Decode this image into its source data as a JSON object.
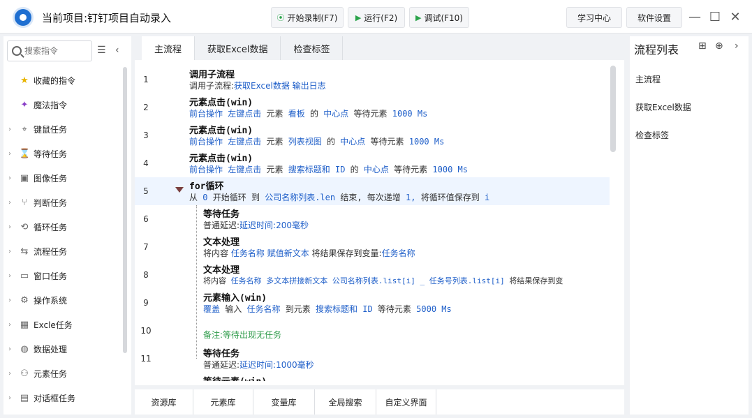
{
  "titlebar": {
    "project_title": "当前项目:钉钉项目自动录入",
    "record_label": "开始录制(F7)",
    "run_label": "运行(F2)",
    "debug_label": "调试(F10)",
    "learn_label": "学习中心",
    "settings_label": "软件设置"
  },
  "sidebar": {
    "search_placeholder": "搜索指令",
    "items": [
      {
        "label": "收藏的指令",
        "icon": "star-icon"
      },
      {
        "label": "魔法指令",
        "icon": "magic-wand-icon"
      },
      {
        "label": "键鼠任务",
        "icon": "mouse-icon"
      },
      {
        "label": "等待任务",
        "icon": "hourglass-icon"
      },
      {
        "label": "图像任务",
        "icon": "image-icon"
      },
      {
        "label": "判断任务",
        "icon": "branch-icon"
      },
      {
        "label": "循环任务",
        "icon": "loop-icon"
      },
      {
        "label": "流程任务",
        "icon": "flow-icon"
      },
      {
        "label": "窗口任务",
        "icon": "window-icon"
      },
      {
        "label": "操作系统",
        "icon": "gear-icon"
      },
      {
        "label": "Excle任务",
        "icon": "excel-icon"
      },
      {
        "label": "数据处理",
        "icon": "database-icon"
      },
      {
        "label": "元素任务",
        "icon": "element-icon"
      },
      {
        "label": "对话框任务",
        "icon": "dialog-icon"
      }
    ]
  },
  "tabs": [
    "主流程",
    "获取Excel数据",
    "检查标签"
  ],
  "flow": {
    "line_numbers": [
      "1",
      "2",
      "3",
      "4",
      "5",
      "6",
      "7",
      "8",
      "9",
      "10",
      "11"
    ],
    "r1_title": "调用子流程",
    "r1_a": "调用子流程:",
    "r1_b": "获取Excel数据 输出日志",
    "r2_title": "元素点击(win)",
    "r2_a": "前台操作",
    "r2_b": "左键点击",
    "r2_c": "元素",
    "r2_d": "看板",
    "r2_e": "的",
    "r2_f": "中心点",
    "r2_g": "等待元素",
    "r2_h": "1000 Ms",
    "r3_title": "元素点击(win)",
    "r3_a": "前台操作",
    "r3_b": "左键点击",
    "r3_c": "元素",
    "r3_d": "列表视图",
    "r3_e": "的",
    "r3_f": "中心点",
    "r3_g": "等待元素",
    "r3_h": "1000 Ms",
    "r4_title": "元素点击(win)",
    "r4_a": "前台操作",
    "r4_b": "左键点击",
    "r4_c": "元素",
    "r4_d": "搜索标题和 ID",
    "r4_e": "的",
    "r4_f": "中心点",
    "r4_g": "等待元素",
    "r4_h": "1000 Ms",
    "r5_title": "for循环",
    "r5_a": "从",
    "r5_b": "0",
    "r5_c": "开始循环 到",
    "r5_d": "公司名称列表.len",
    "r5_e": "结束, 每次递增",
    "r5_f": "1,",
    "r5_g": "将循环值保存到",
    "r5_h": "i",
    "r6_title": "等待任务",
    "r6_a": "普通延迟:",
    "r6_b": "延迟时间:200毫秒",
    "r7_title": "文本处理",
    "r7_a": "将内容",
    "r7_b": "任务名称",
    "r7_c": "赋值新文本",
    "r7_d": "将结果保存到变量:",
    "r7_e": "任务名称",
    "r8_title": "文本处理",
    "r8_a": "将内容",
    "r8_b": "任务名称",
    "r8_c": "多文本拼接新文本",
    "r8_d": "公司名称列表.list[i] _ 任务号列表.list[i]",
    "r8_e": "将结果保存到变",
    "r9_title": "元素输入(win)",
    "r9_a": "覆盖",
    "r9_b": "输入",
    "r9_c": "任务名称",
    "r9_d": "到元素",
    "r9_e": "搜索标题和 ID",
    "r9_f": "等待元素",
    "r9_g": "5000 Ms",
    "r10_comment": "备注:等待出现无任务",
    "r11_title": "等待任务",
    "r11_a": "普通延迟:",
    "r11_b": "延迟时间:1000毫秒",
    "r12_title": "等待元素(win)"
  },
  "bottom_tabs": [
    "资源库",
    "元素库",
    "变量库",
    "全局搜索",
    "自定义界面"
  ],
  "right": {
    "title": "流程列表",
    "items": [
      "主流程",
      "获取Excel数据",
      "检查标签"
    ]
  }
}
